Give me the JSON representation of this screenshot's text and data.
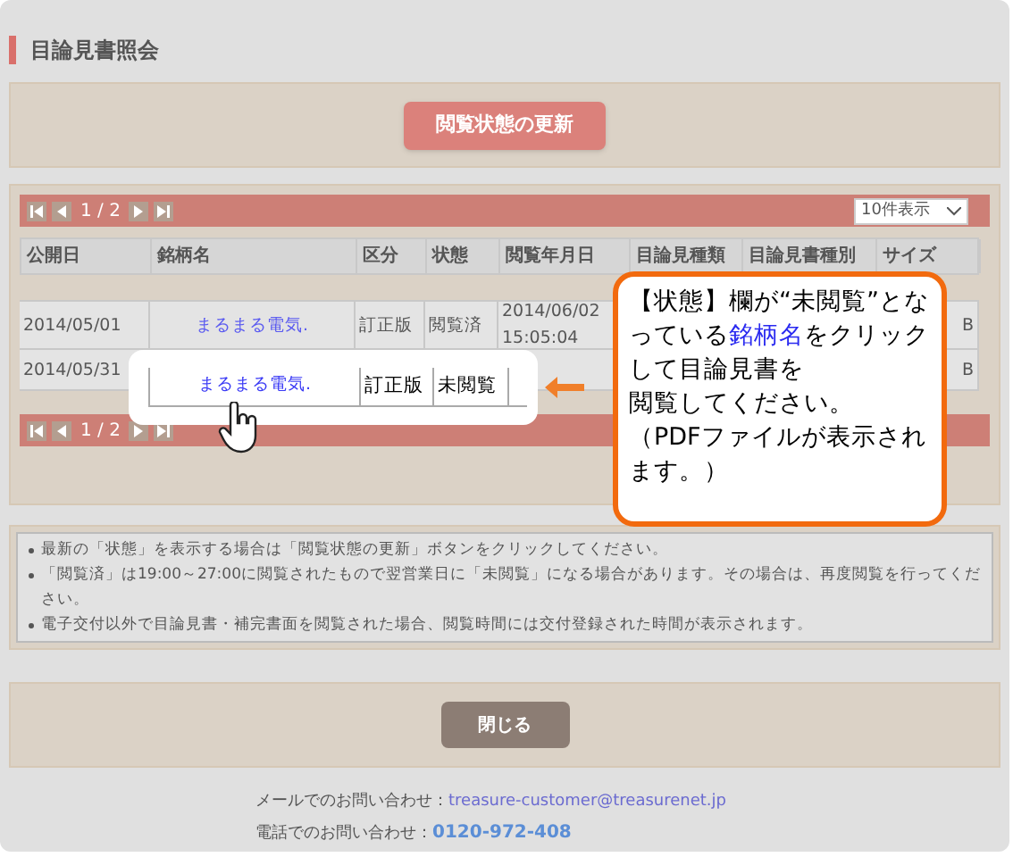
{
  "page_title": "目論見書照会",
  "refresh_button": "閲覧状態の更新",
  "pagination_top": {
    "page": "1 / 2",
    "per_page": "10件表示"
  },
  "table": {
    "columns": [
      "公開日",
      "銘柄名",
      "区分",
      "状態",
      "閲覧年月日",
      "目論見種類",
      "目論見書種別",
      "サイズ"
    ],
    "rows": [
      {
        "cells": [
          "2014/05/01",
          "まるまる電気.",
          "訂正版",
          "閲覧済",
          "2014/06/02 15:05:04",
          "",
          "",
          "B"
        ]
      },
      {
        "cells": [
          "2014/05/31",
          "",
          "",
          "",
          "",
          "",
          "",
          "B"
        ]
      }
    ]
  },
  "pagination_bottom": {
    "page": "1 / 2"
  },
  "zoom_popup": {
    "cells": [
      "まるまる電気.",
      "訂正版",
      "未閲覧"
    ]
  },
  "callout": {
    "paragraphs": [
      [
        {
          "kind": "plain",
          "text": "【状態】欄が“未閲覧”となっている"
        },
        {
          "kind": "link",
          "text": "銘柄名"
        },
        {
          "kind": "plain",
          "text": "をクリックして目論見書を"
        }
      ],
      [
        {
          "kind": "plain",
          "text": "閲覧してください。"
        }
      ],
      [
        {
          "kind": "plain",
          "text": "（PDFファイルが表示されます。）"
        }
      ]
    ]
  },
  "notes": [
    "最新の「状態」を表示する場合は「閲覧状態の更新」ボタンをクリックしてください。",
    "「閲覧済」は19:00～27:00に閲覧されたもので翌営業日に「未閲覧」になる場合があります。その場合は、再度閲覧を行ってください。",
    "電子交付以外で目論見書・補完書面を閲覧された場合、閲覧時間には交付登録された時間が表示されます。"
  ],
  "close_button": "閉じる",
  "footer": [
    {
      "label": "メールでのお問い合わせ：",
      "value": "treasure-customer@treasurenet.jp",
      "kind": "email"
    },
    {
      "label": "電話でのお問い合わせ：",
      "value": "0120-972-408",
      "kind": "phone"
    }
  ]
}
